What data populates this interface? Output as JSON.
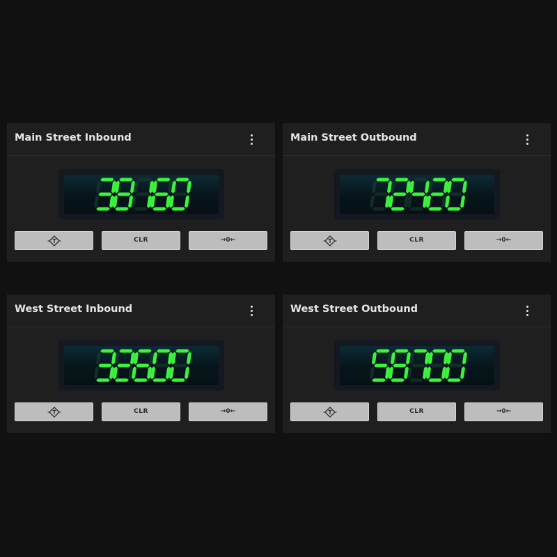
{
  "colors": {
    "background": "#111111",
    "card": "#1f1f1f",
    "segment_on": "#3cf23c",
    "segment_off": "#1d3f33",
    "button": "#bdbdbd"
  },
  "scales": [
    {
      "title": "Main Street Inbound",
      "reading": "38160",
      "buttons": {
        "tare_icon": "tare-icon",
        "clear_label": "CLR",
        "zero_label": "→0←"
      }
    },
    {
      "title": "Main Street Outbound",
      "reading": "72420",
      "buttons": {
        "tare_icon": "tare-icon",
        "clear_label": "CLR",
        "zero_label": "→0←"
      }
    },
    {
      "title": "West Street Inbound",
      "reading": "32600",
      "buttons": {
        "tare_icon": "tare-icon",
        "clear_label": "CLR",
        "zero_label": "→0←"
      }
    },
    {
      "title": "West Street Outbound",
      "reading": "58700",
      "buttons": {
        "tare_icon": "tare-icon",
        "clear_label": "CLR",
        "zero_label": "→0←"
      }
    }
  ]
}
